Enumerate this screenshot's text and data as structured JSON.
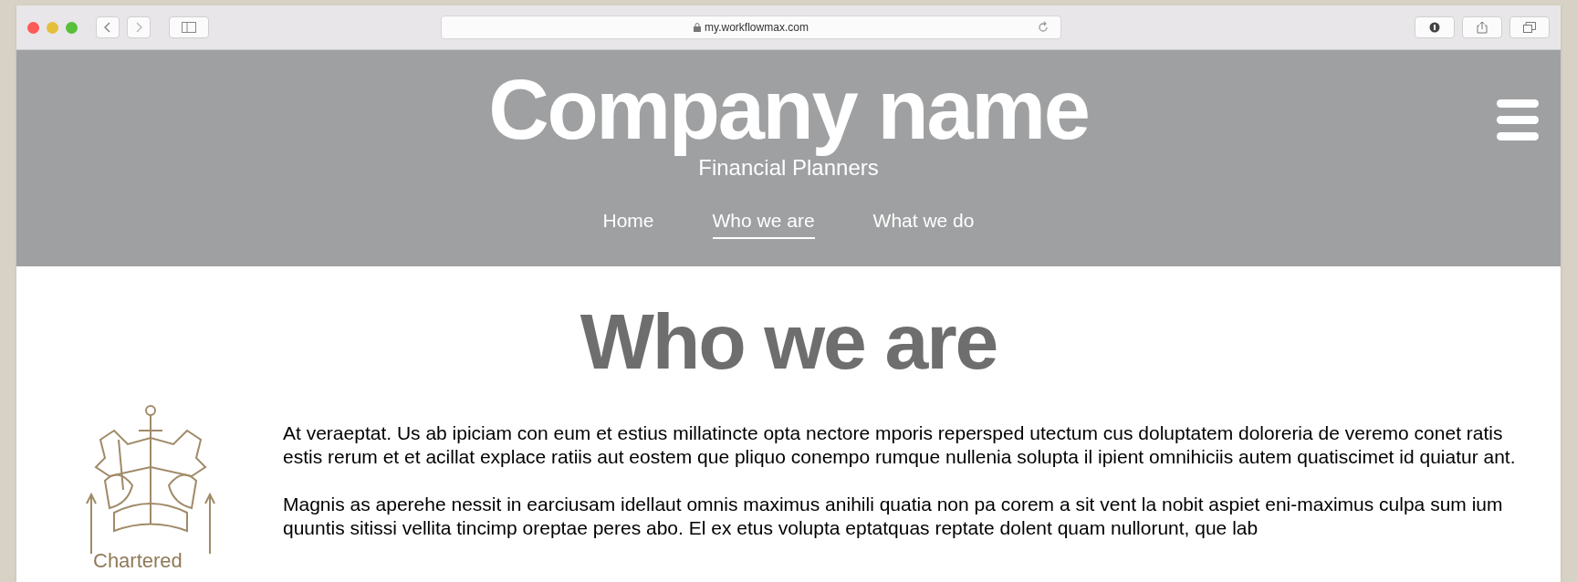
{
  "browser": {
    "url": "my.workflowmax.com"
  },
  "header": {
    "title": "Company name",
    "subtitle": "Financial Planners",
    "nav": [
      {
        "label": "Home",
        "selected": false
      },
      {
        "label": "Who we are",
        "selected": true
      },
      {
        "label": "What we do",
        "selected": false
      }
    ]
  },
  "content": {
    "heading": "Who we are",
    "logo_caption": "Chartered",
    "paragraphs": [
      "At veraeptat. Us ab ipiciam con eum et estius millatincte opta nectore mporis repersped utectum cus doluptatem doloreria de veremo conet ratis estis rerum et et acillat explace ratiis aut eostem que pliquo conempo rumque nullenia solupta il ipient omnihiciis autem quatiscimet id quiatur ant.",
      "Magnis as aperehe nessit in earciusam idellaut omnis maximus anihili quatia non pa corem a sit vent la nobit aspiet eni-maximus culpa sum ium quuntis sitissi vellita tincimp oreptae peres abo. El ex etus volupta eptatquas reptate dolent quam nullorunt, que lab"
    ]
  }
}
